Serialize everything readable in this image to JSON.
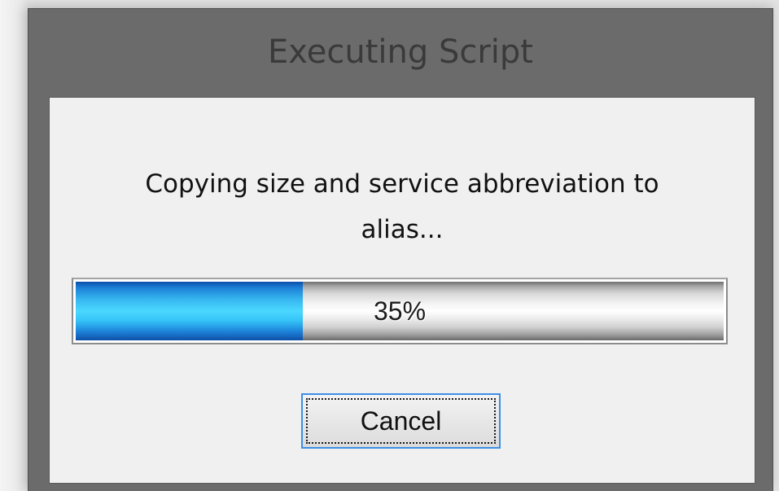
{
  "dialog": {
    "title": "Executing Script",
    "message_line1": "Copying size and service abbreviation to",
    "message_line2": "alias...",
    "progress": {
      "percent": 35,
      "label": "35%"
    },
    "cancel_label": "Cancel"
  },
  "colors": {
    "window_frame": "#6b6b6b",
    "client_background": "#f0f0f0",
    "progress_fill": "#36b6f0",
    "button_focus_border": "#3c8fe6"
  }
}
